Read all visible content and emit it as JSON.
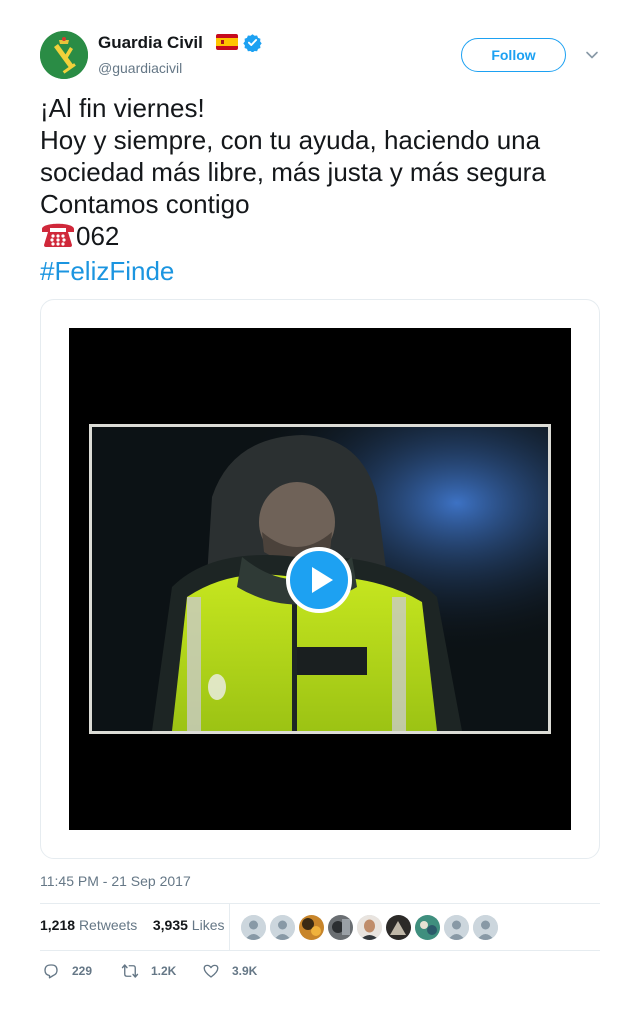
{
  "header": {
    "name": "Guardia Civil",
    "handle": "@guardiacivil",
    "follow_label": "Follow"
  },
  "tweet": {
    "lines": [
      "¡Al fin viernes!",
      "Hoy y siempre, con tu ayuda, haciendo una",
      "sociedad más libre, más justa y más segura",
      "Contamos contigo"
    ],
    "phone_number": "062",
    "hashtag": "#FelizFinde"
  },
  "meta": {
    "timestamp": "11:45 PM - 21 Sep 2017",
    "retweets_count": "1,218",
    "retweets_label": "Retweets",
    "likes_count": "3,935",
    "likes_label": "Likes"
  },
  "actions": {
    "replies": "229",
    "retweets": "1.2K",
    "likes": "3.9K"
  },
  "colors": {
    "accent": "#1da1f2",
    "hashtag": "#1b95e0",
    "muted": "#657786",
    "avatar_bg": "#2a8c45"
  },
  "icons": [
    "verified-badge-icon",
    "spain-flag-icon",
    "caret-down-icon",
    "telephone-icon",
    "play-icon",
    "reply-icon",
    "retweet-icon",
    "heart-icon"
  ]
}
